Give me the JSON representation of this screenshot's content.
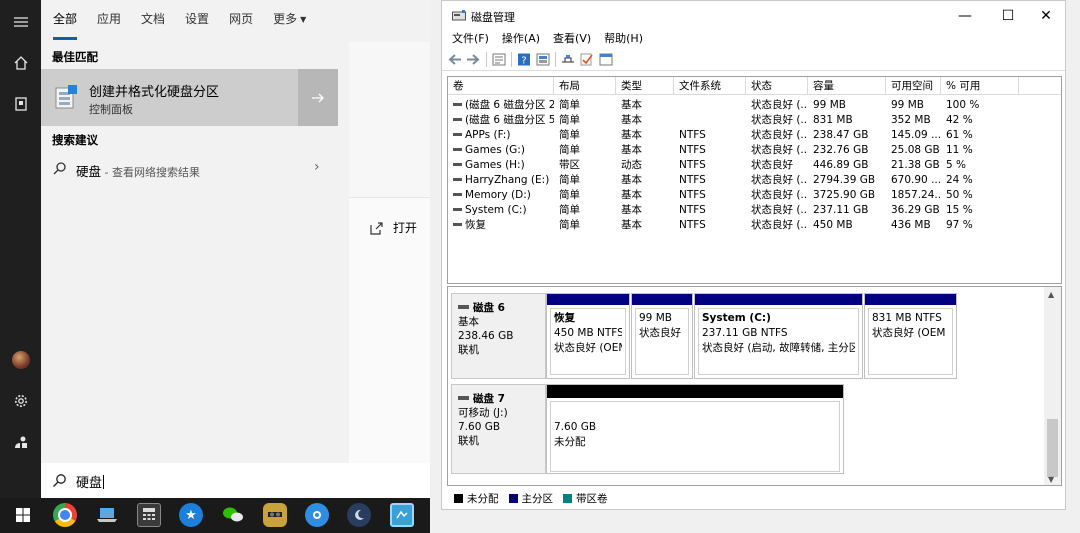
{
  "search_panel": {
    "tabs": [
      {
        "label": "全部",
        "active": true
      },
      {
        "label": "应用"
      },
      {
        "label": "文档"
      },
      {
        "label": "设置"
      },
      {
        "label": "网页"
      },
      {
        "label": "更多"
      }
    ],
    "best_match_heading": "最佳匹配",
    "best_match": {
      "title": "创建并格式化硬盘分区",
      "subtitle": "控制面板"
    },
    "suggestions_heading": "搜索建议",
    "suggestion": {
      "term": "硬盘",
      "hint": " - 查看网络搜索结果"
    },
    "open_label": "打开",
    "search_value": "硬盘"
  },
  "taskbar": {
    "icons": [
      "windows-icon",
      "chrome-icon",
      "this-pc-icon",
      "calculator-icon",
      "star-app-icon",
      "wechat-icon",
      "game-icon",
      "browser-icon",
      "moon-app-icon",
      "app-icon"
    ]
  },
  "window": {
    "title": "磁盘管理",
    "menu": [
      "文件(F)",
      "操作(A)",
      "查看(V)",
      "帮助(H)"
    ],
    "controls": {
      "minimize": "—",
      "maximize": "☐",
      "close": "✕"
    },
    "columns": [
      "卷",
      "布局",
      "类型",
      "文件系统",
      "状态",
      "容量",
      "可用空间",
      "% 可用"
    ],
    "volumes": [
      [
        "(磁盘 6 磁盘分区 2)",
        "简单",
        "基本",
        "",
        "状态良好 (...",
        "99 MB",
        "99 MB",
        "100 %"
      ],
      [
        "(磁盘 6 磁盘分区 5)",
        "简单",
        "基本",
        "",
        "状态良好 (...",
        "831 MB",
        "352 MB",
        "42 %"
      ],
      [
        "APPs (F:)",
        "简单",
        "基本",
        "NTFS",
        "状态良好 (...",
        "238.47 GB",
        "145.09 ...",
        "61 %"
      ],
      [
        "Games (G:)",
        "简单",
        "基本",
        "NTFS",
        "状态良好 (...",
        "232.76 GB",
        "25.08 GB",
        "11 %"
      ],
      [
        "Games (H:)",
        "带区",
        "动态",
        "NTFS",
        "状态良好",
        "446.89 GB",
        "21.38 GB",
        "5 %"
      ],
      [
        "HarryZhang (E:)",
        "简单",
        "基本",
        "NTFS",
        "状态良好 (...",
        "2794.39 GB",
        "670.90 ...",
        "24 %"
      ],
      [
        "Memory (D:)",
        "简单",
        "基本",
        "NTFS",
        "状态良好 (...",
        "3725.90 GB",
        "1857.24...",
        "50 %"
      ],
      [
        "System (C:)",
        "简单",
        "基本",
        "NTFS",
        "状态良好 (...",
        "237.11 GB",
        "36.29 GB",
        "15 %"
      ],
      [
        "恢复",
        "简单",
        "基本",
        "NTFS",
        "状态良好 (...",
        "450 MB",
        "436 MB",
        "97 %"
      ]
    ],
    "disks": [
      {
        "name": "磁盘 6",
        "type": "基本",
        "size": "238.46 GB",
        "status": "联机",
        "partitions": [
          {
            "lines": [
              "恢复",
              "450 MB NTFS",
              "状态良好 (OEM"
            ],
            "bold_first": true
          },
          {
            "lines": [
              "",
              "99 MB",
              "状态良好 (E"
            ],
            "bold_first": false
          },
          {
            "lines": [
              "System  (C:)",
              "237.11 GB NTFS",
              "状态良好 (启动, 故障转储, 主分区)"
            ],
            "bold_first": true
          },
          {
            "lines": [
              "",
              "831 MB NTFS",
              "状态良好 (OEM 分"
            ],
            "bold_first": false
          }
        ]
      },
      {
        "name": "磁盘 7",
        "type": "可移动 (J:)",
        "size": "7.60 GB",
        "status": "联机",
        "partitions": [
          {
            "lines": [
              "7.60 GB",
              "未分配"
            ],
            "bold_first": false
          }
        ]
      }
    ],
    "legend": [
      {
        "label": "未分配",
        "color": "#000000"
      },
      {
        "label": "主分区",
        "color": "#000080"
      },
      {
        "label": "带区卷",
        "color": "#008080"
      }
    ]
  },
  "colors": {
    "accent": "#0063b1",
    "primary_partition": "#000080",
    "unallocated": "#000000"
  }
}
